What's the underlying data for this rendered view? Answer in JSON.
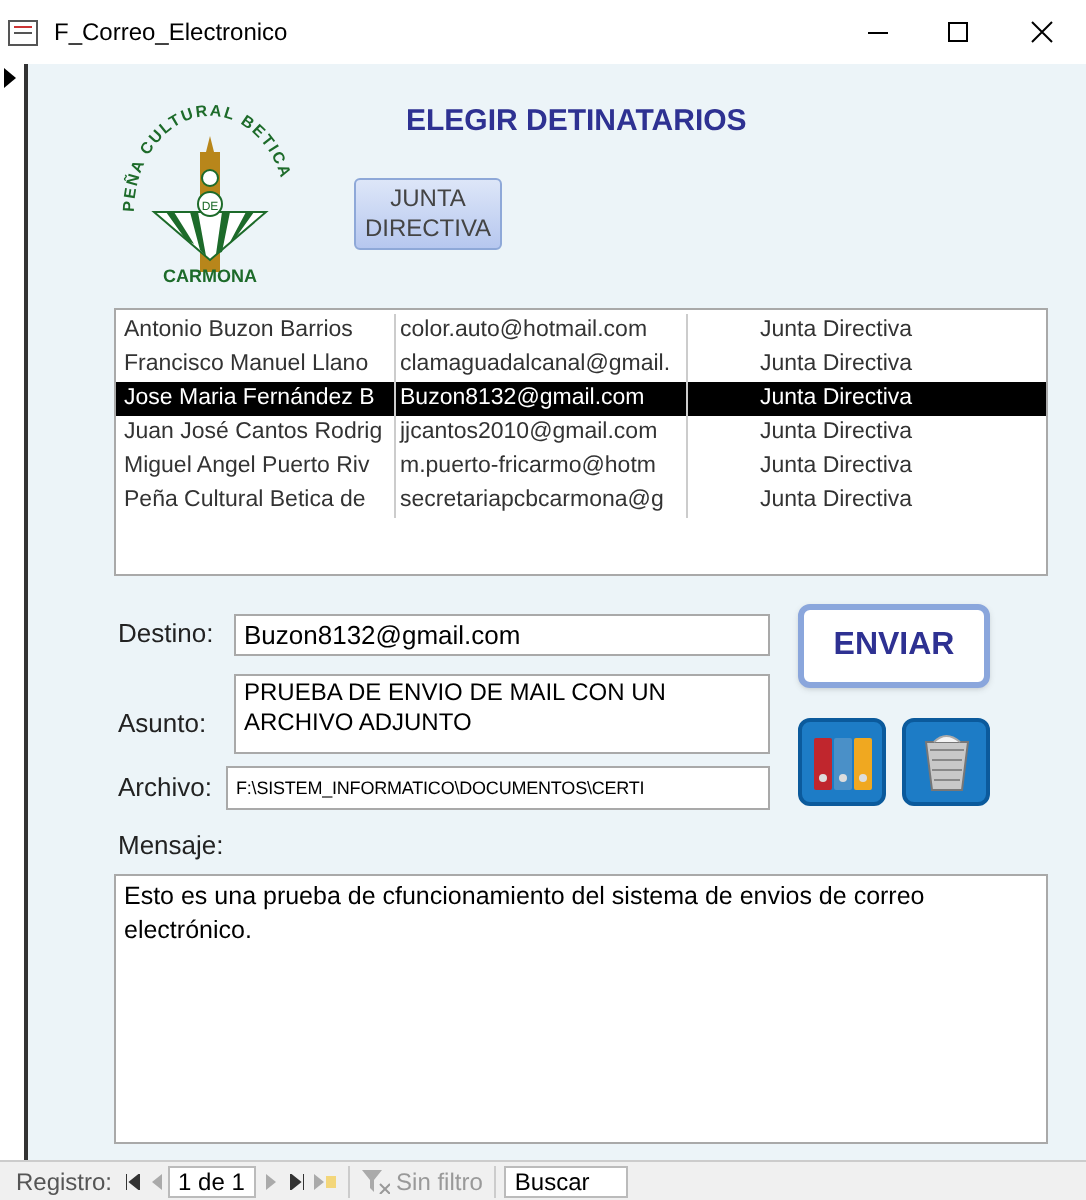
{
  "window": {
    "title": "F_Correo_Electronico"
  },
  "logo": {
    "arc_text": "PEÑA CULTURAL BETICA",
    "bottom_text": "CARMONA",
    "badge_text": "DE"
  },
  "heading": "ELEGIR DETINATARIOS",
  "filter_button": "JUNTA DIRECTIVA",
  "recipients": [
    {
      "name": "Antonio Buzon Barrios",
      "email": "color.auto@hotmail.com",
      "group": "Junta Directiva",
      "selected": false
    },
    {
      "name": "Francisco Manuel Llano",
      "email": "clamaguadalcanal@gmail.",
      "group": "Junta Directiva",
      "selected": false
    },
    {
      "name": "Jose Maria Fernández B",
      "email": "Buzon8132@gmail.com",
      "group": "Junta Directiva",
      "selected": true
    },
    {
      "name": "Juan José Cantos  Rodrig",
      "email": "jjcantos2010@gmail.com",
      "group": "Junta Directiva",
      "selected": false
    },
    {
      "name": "Miguel Angel Puerto Riv",
      "email": "m.puerto-fricarmo@hotm",
      "group": "Junta Directiva",
      "selected": false
    },
    {
      "name": "Peña Cultural Betica de",
      "email": "secretariapcbcarmona@g",
      "group": "Junta Directiva",
      "selected": false
    }
  ],
  "form": {
    "destino": {
      "label": "Destino:",
      "value": "Buzon8132@gmail.com"
    },
    "asunto": {
      "label": "Asunto:",
      "value": "PRUEBA DE ENVIO DE MAIL CON UN ARCHIVO ADJUNTO"
    },
    "archivo": {
      "label": "Archivo:",
      "value": "F:\\SISTEM_INFORMATICO\\DOCUMENTOS\\CERTI"
    },
    "mensaje": {
      "label": "Mensaje:",
      "value": "Esto es una prueba de cfuncionamiento del sistema de envios de correo electrónico."
    }
  },
  "send_button": "ENVIAR",
  "status_bar": {
    "label": "Registro:",
    "record": "1 de 1",
    "filter": "Sin filtro",
    "search_placeholder": "Buscar"
  }
}
